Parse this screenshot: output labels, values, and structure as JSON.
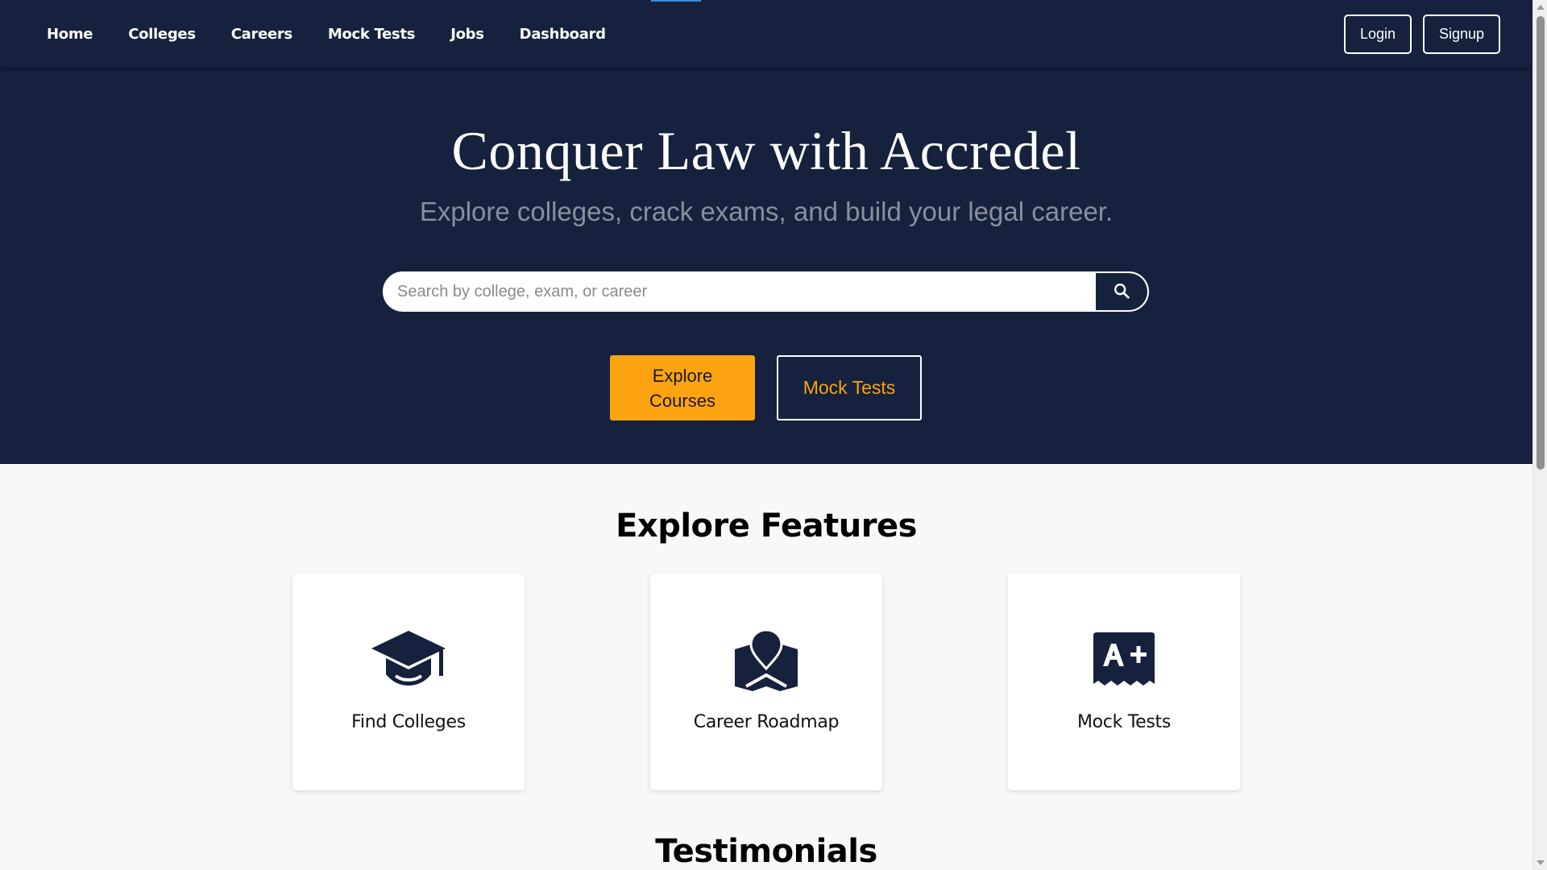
{
  "nav": {
    "links": [
      "Home",
      "Colleges",
      "Careers",
      "Mock Tests",
      "Jobs",
      "Dashboard"
    ],
    "login": "Login",
    "signup": "Signup"
  },
  "hero": {
    "title": "Conquer Law with Accredel",
    "subtitle": "Explore colleges, crack exams, and build your legal career.",
    "search_placeholder": "Search by college, exam, or career",
    "search_icon": "search-icon",
    "primary_button": "Explore Courses",
    "secondary_button": "Mock Tests"
  },
  "features": {
    "title": "Explore Features",
    "cards": [
      {
        "label": "Find Colleges",
        "icon": "graduation-cap-icon"
      },
      {
        "label": "Career Roadmap",
        "icon": "map-location-icon"
      },
      {
        "label": "Mock Tests",
        "icon": "grade-a-plus-icon"
      }
    ]
  },
  "testimonials": {
    "title": "Testimonials"
  },
  "colors": {
    "navy": "#16213e",
    "accent": "#fca311",
    "background": "#f8f8f8"
  }
}
